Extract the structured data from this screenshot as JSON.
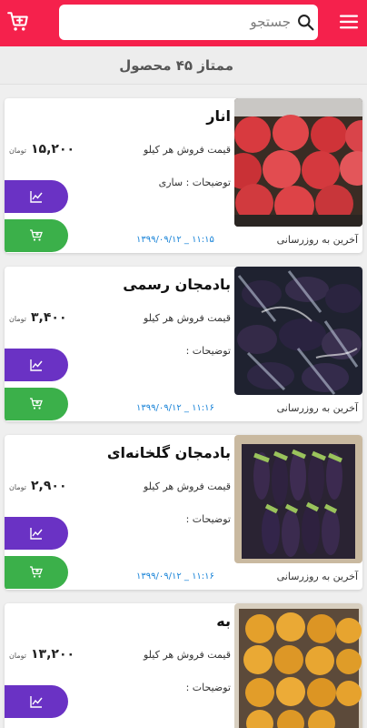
{
  "header": {
    "search_value": "جستجو",
    "bar_color": "#f5214c"
  },
  "section": {
    "title": "ممتاز ۴۵ محصول"
  },
  "labels": {
    "price_label": "قیمت فروش هر کیلو",
    "unit": "تومان",
    "last_update": "آخرین به روزرسانی"
  },
  "products": [
    {
      "name": "انار",
      "price": "۱۵,۲۰۰",
      "desc": "توضیحات : ساری",
      "date": "۱۳۹۹/۰۹/۱۲ _ ۱۱:۱۵",
      "image": "pomegranates"
    },
    {
      "name": "بادمجان رسمی",
      "price": "۳,۴۰۰",
      "desc": "توضیحات :",
      "date": "۱۳۹۹/۰۹/۱۲ _ ۱۱:۱۶",
      "image": "eggplants-bagged"
    },
    {
      "name": "بادمجان گلخانه‌ای",
      "price": "۲,۹۰۰",
      "desc": "توضیحات :",
      "date": "۱۳۹۹/۰۹/۱۲ _ ۱۱:۱۶",
      "image": "eggplants-boxed"
    },
    {
      "name": "به",
      "price": "۱۳,۲۰۰",
      "desc": "توضیحات :",
      "date": "",
      "image": "quinces"
    }
  ],
  "colors": {
    "chart_button": "#6a32c4",
    "cart_button": "#3bb04a",
    "date": "#1a84d8"
  }
}
